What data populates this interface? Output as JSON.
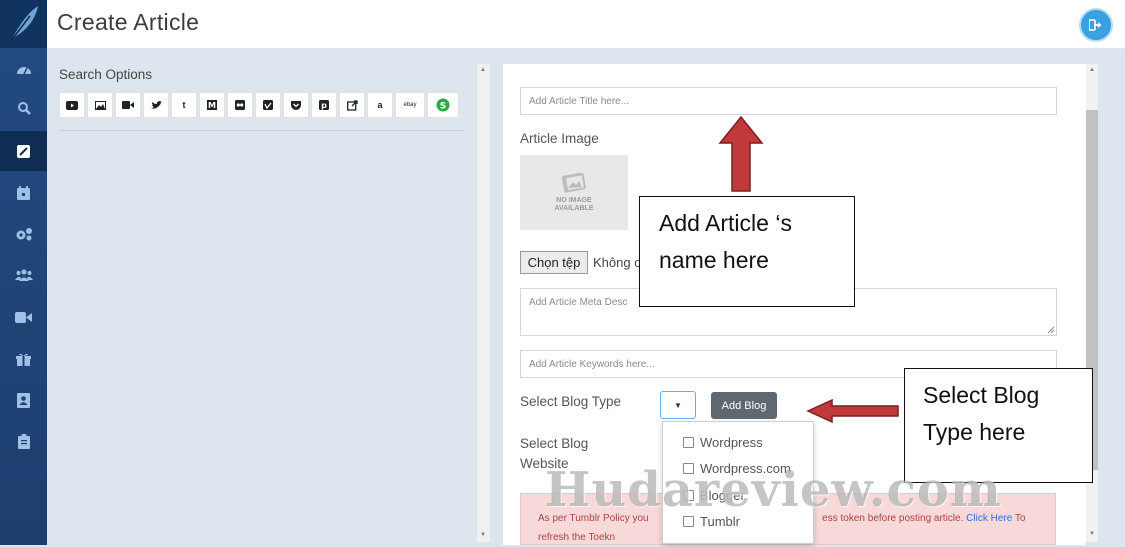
{
  "header": {
    "title": "Create Article"
  },
  "sidebar": {
    "icons": [
      "dashboard-icon",
      "search-icon",
      "edit-icon",
      "calendar-icon",
      "gears-icon",
      "users-icon",
      "video-icon",
      "gift-icon",
      "address-book-icon",
      "clipboard-icon"
    ]
  },
  "search": {
    "label": "Search Options",
    "sources": [
      "youtube-icon",
      "image-icon",
      "video-camera-icon",
      "twitter-icon",
      "tumblr-icon",
      "medium-icon",
      "flickr-icon",
      "vimeo-icon",
      "pocket-icon",
      "pinterest-icon",
      "external-link-icon",
      "amazon-icon",
      "ebay-icon",
      "shopzilla-icon"
    ]
  },
  "form": {
    "title_placeholder": "Add Article Title here...",
    "image_label": "Article Image",
    "no_image_text": "NO IMAGE AVAILABLE",
    "choose_file": "Chọn tệp",
    "no_file": "Không c",
    "meta_placeholder": "Add Article Meta Description here...",
    "meta_visible": "Add Article Meta Desc",
    "keywords_placeholder": "Add Article Keywords here...",
    "blog_type_label": "Select Blog Type",
    "add_blog": "Add Blog",
    "blog_website_label_1": "Select Blog",
    "blog_website_label_2": "Website",
    "blog_types": [
      "Wordpress",
      "Wordpress.com",
      "Blogger",
      "Tumblr"
    ]
  },
  "alert": {
    "text_before": "As per Tumblr Policy you",
    "text_middle": "ess token before posting article.",
    "link": "Click Here",
    "text_after": "To",
    "line2": "refresh the Toekn"
  },
  "annotations": {
    "article_name": [
      "Add Article ‘s",
      "name here"
    ],
    "blog_type": [
      "Select Blog",
      "Type here"
    ]
  },
  "watermark": "Hudareview.com",
  "colors": {
    "sidebar": "#1d3f6f",
    "accent": "#3aa0e0",
    "button": "#5f6870",
    "alert_bg": "#f7d9d9",
    "arrow": "#b8282e"
  }
}
